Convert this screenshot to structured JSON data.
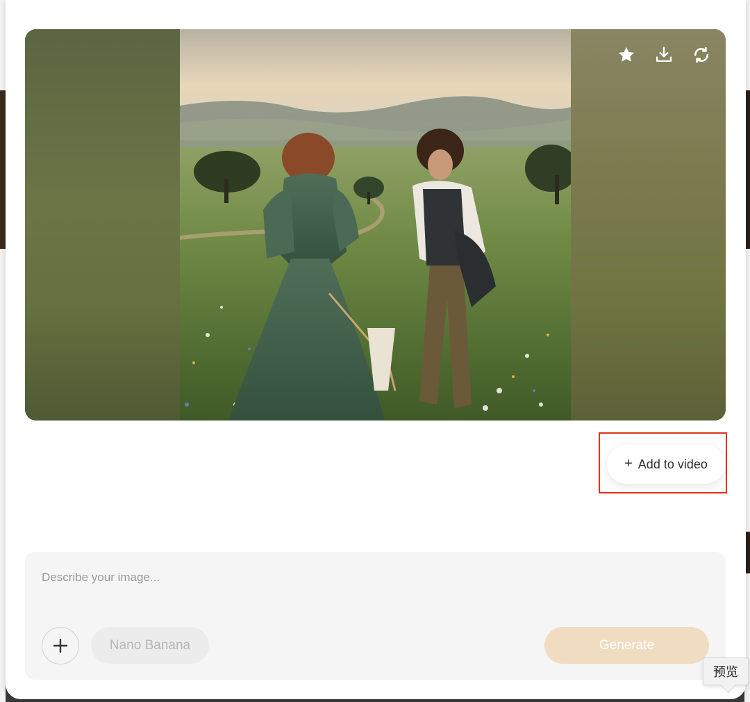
{
  "image_toolbar": {
    "favorite_icon": "star-icon",
    "download_icon": "download-icon",
    "regenerate_icon": "refresh-icon"
  },
  "add_to_video": {
    "icon": "plus-icon",
    "label": "Add to video",
    "highlight_color": "#e4331c"
  },
  "composer": {
    "placeholder": "Describe your image...",
    "value": "",
    "attach_icon": "plus-icon",
    "model_label": "Nano Banana",
    "generate_label": "Generate"
  },
  "tooltip": {
    "label": "预览"
  },
  "colors": {
    "generate_bg": "#f0dcc0",
    "composer_bg": "#f5f5f5",
    "highlight": "#e4331c"
  }
}
